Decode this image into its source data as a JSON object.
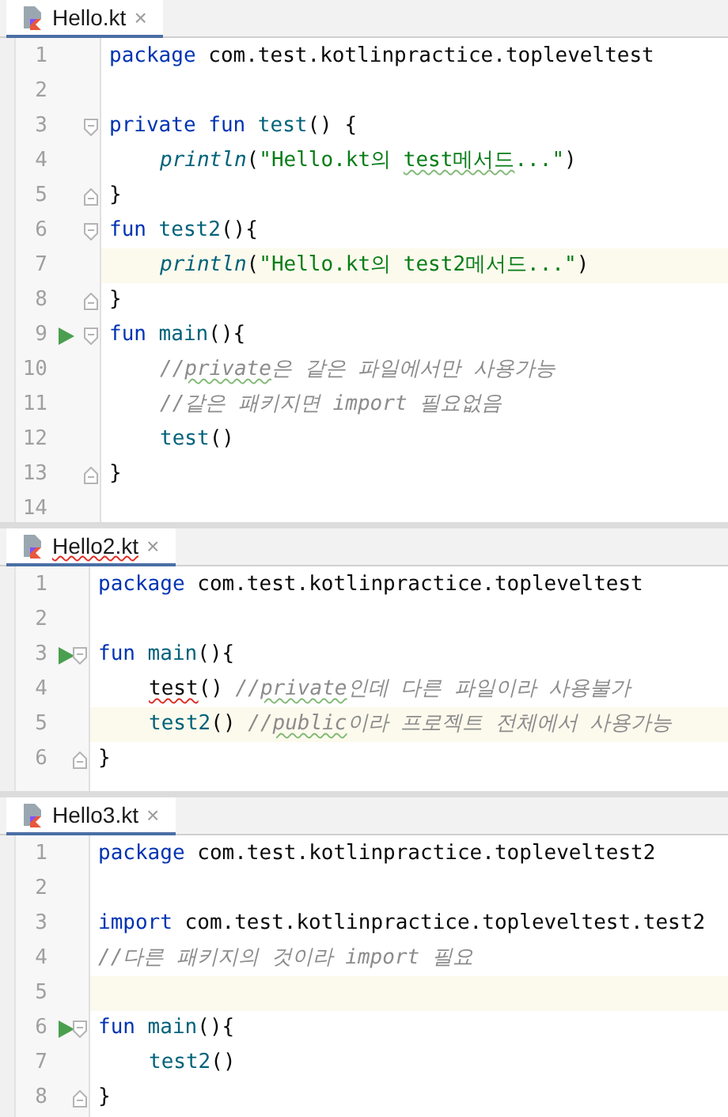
{
  "panels": [
    {
      "tab": {
        "label": "Hello.kt",
        "close": "×",
        "error": false
      },
      "lines": [
        {
          "number": "1",
          "tokens": [
            {
              "text": "package",
              "kind": "keyword"
            },
            {
              "text": " com.test.kotlinpractice.topleveltest",
              "kind": "plain"
            }
          ]
        },
        {
          "number": "2"
        },
        {
          "number": "3",
          "fold_start": true,
          "tokens": [
            {
              "text": "private fun",
              "kind": "keyword"
            },
            {
              "text": " test",
              "kind": "func"
            },
            {
              "text": "() {",
              "kind": "plain"
            }
          ]
        },
        {
          "number": "4",
          "indented": true,
          "tokens": [
            {
              "text": "println",
              "kind": "call"
            },
            {
              "text": "(",
              "kind": "plain"
            },
            {
              "text": "\"Hello.kt의 ",
              "kind": "string"
            },
            {
              "text": "test메서드",
              "kind": "string",
              "typo_underline": true
            },
            {
              "text": "...\"",
              "kind": "string"
            },
            {
              "text": ")",
              "kind": "plain"
            }
          ]
        },
        {
          "number": "5",
          "fold_end": true,
          "tokens": [
            {
              "text": "}",
              "kind": "plain"
            }
          ]
        },
        {
          "number": "6",
          "fold_start": true,
          "tokens": [
            {
              "text": "fun",
              "kind": "keyword"
            },
            {
              "text": " test2",
              "kind": "func"
            },
            {
              "text": "(){",
              "kind": "plain"
            }
          ]
        },
        {
          "number": "7",
          "current": true,
          "indented": true,
          "tokens": [
            {
              "text": "println",
              "kind": "call"
            },
            {
              "text": "(",
              "kind": "plain"
            },
            {
              "text": "\"Hello.kt의 test2메서드...\"",
              "kind": "string"
            },
            {
              "text": ")",
              "kind": "plain"
            }
          ]
        },
        {
          "number": "8",
          "fold_end": true,
          "tokens": [
            {
              "text": "}",
              "kind": "plain"
            }
          ]
        },
        {
          "number": "9",
          "run": true,
          "fold_start": true,
          "tokens": [
            {
              "text": "fun",
              "kind": "keyword"
            },
            {
              "text": " main",
              "kind": "func"
            },
            {
              "text": "(){",
              "kind": "plain"
            }
          ]
        },
        {
          "number": "10",
          "indented": true,
          "tokens": [
            {
              "text": "//",
              "kind": "comment"
            },
            {
              "text": "private",
              "kind": "comment",
              "typo_underline": true
            },
            {
              "text": "은 같은 파일에서만 사용가능",
              "kind": "comment"
            }
          ]
        },
        {
          "number": "11",
          "indented": true,
          "tokens": [
            {
              "text": "//같은 패키지면 import 필요없음",
              "kind": "comment"
            }
          ]
        },
        {
          "number": "12",
          "indented": true,
          "tokens": [
            {
              "text": "test",
              "kind": "func"
            },
            {
              "text": "()",
              "kind": "plain"
            }
          ]
        },
        {
          "number": "13",
          "fold_end": true,
          "tokens": [
            {
              "text": "}",
              "kind": "plain"
            }
          ]
        },
        {
          "number": "14"
        }
      ]
    },
    {
      "tab": {
        "label": "Hello2.kt",
        "close": "×",
        "error": true
      },
      "lines": [
        {
          "number": "1",
          "tokens": [
            {
              "text": "package",
              "kind": "keyword"
            },
            {
              "text": " com.test.kotlinpractice.topleveltest",
              "kind": "plain"
            }
          ]
        },
        {
          "number": "2"
        },
        {
          "number": "3",
          "run": true,
          "fold_start": true,
          "tokens": [
            {
              "text": "fun",
              "kind": "keyword"
            },
            {
              "text": " main",
              "kind": "func"
            },
            {
              "text": "(){",
              "kind": "plain"
            }
          ]
        },
        {
          "number": "4",
          "indented": true,
          "tokens": [
            {
              "text": "test",
              "kind": "plain",
              "error_underline": true
            },
            {
              "text": "() ",
              "kind": "plain"
            },
            {
              "text": "//",
              "kind": "comment"
            },
            {
              "text": "private",
              "kind": "comment",
              "typo_underline": true
            },
            {
              "text": "인데 다른 파일이라 사용불가",
              "kind": "comment"
            }
          ]
        },
        {
          "number": "5",
          "current": true,
          "indented": true,
          "tokens": [
            {
              "text": "test2",
              "kind": "func"
            },
            {
              "text": "() ",
              "kind": "plain"
            },
            {
              "text": "//",
              "kind": "comment"
            },
            {
              "text": "public",
              "kind": "comment",
              "typo_underline": true
            },
            {
              "text": "이라 프로젝트 전체에서 사용가능",
              "kind": "comment"
            }
          ]
        },
        {
          "number": "6",
          "fold_end": true,
          "tokens": [
            {
              "text": "}",
              "kind": "plain"
            }
          ]
        }
      ]
    },
    {
      "tab": {
        "label": "Hello3.kt",
        "close": "×",
        "error": false
      },
      "lines": [
        {
          "number": "1",
          "tokens": [
            {
              "text": "package",
              "kind": "keyword"
            },
            {
              "text": " com.test.kotlinpractice.topleveltest2",
              "kind": "plain"
            }
          ]
        },
        {
          "number": "2"
        },
        {
          "number": "3",
          "tokens": [
            {
              "text": "import",
              "kind": "keyword"
            },
            {
              "text": " com.test.kotlinpractice.topleveltest.test2",
              "kind": "plain"
            }
          ]
        },
        {
          "number": "4",
          "tokens": [
            {
              "text": "//다른 패키지의 것이라 import 필요",
              "kind": "comment"
            }
          ]
        },
        {
          "number": "5",
          "current": true
        },
        {
          "number": "6",
          "run": true,
          "fold_start": true,
          "tokens": [
            {
              "text": "fun",
              "kind": "keyword"
            },
            {
              "text": " main",
              "kind": "func"
            },
            {
              "text": "(){",
              "kind": "plain"
            }
          ]
        },
        {
          "number": "7",
          "indented": true,
          "tokens": [
            {
              "text": "test2",
              "kind": "func"
            },
            {
              "text": "()",
              "kind": "plain"
            }
          ]
        },
        {
          "number": "8",
          "fold_end": true,
          "tokens": [
            {
              "text": "}",
              "kind": "plain"
            }
          ]
        }
      ]
    }
  ]
}
